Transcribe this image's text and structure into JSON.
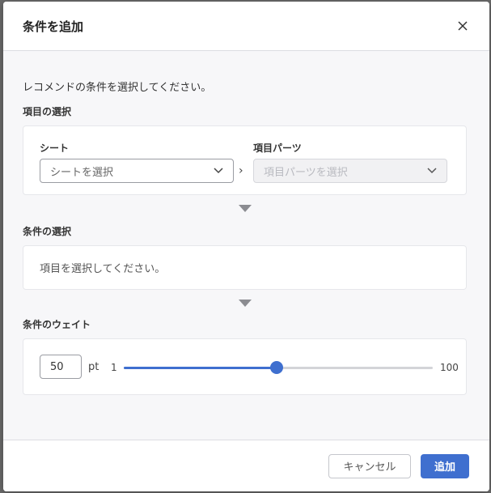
{
  "dialog": {
    "title": "条件を追加",
    "close_icon": "close-icon"
  },
  "intro": "レコメンドの条件を選択してください。",
  "item_section": {
    "label": "項目の選択",
    "sheet": {
      "label": "シート",
      "placeholder": "シートを選択"
    },
    "separator": "›",
    "parts": {
      "label": "項目パーツ",
      "placeholder": "項目パーツを選択",
      "disabled": true
    }
  },
  "condition_section": {
    "label": "条件の選択",
    "message": "項目を選択してください。"
  },
  "weight_section": {
    "label": "条件のウェイト",
    "value": "50",
    "unit": "pt",
    "min": "1",
    "max": "100",
    "slider_value": 50
  },
  "footer": {
    "cancel_label": "キャンセル",
    "add_label": "追加"
  },
  "colors": {
    "accent": "#3f6fcf",
    "overlay": "#5d5d5d"
  }
}
